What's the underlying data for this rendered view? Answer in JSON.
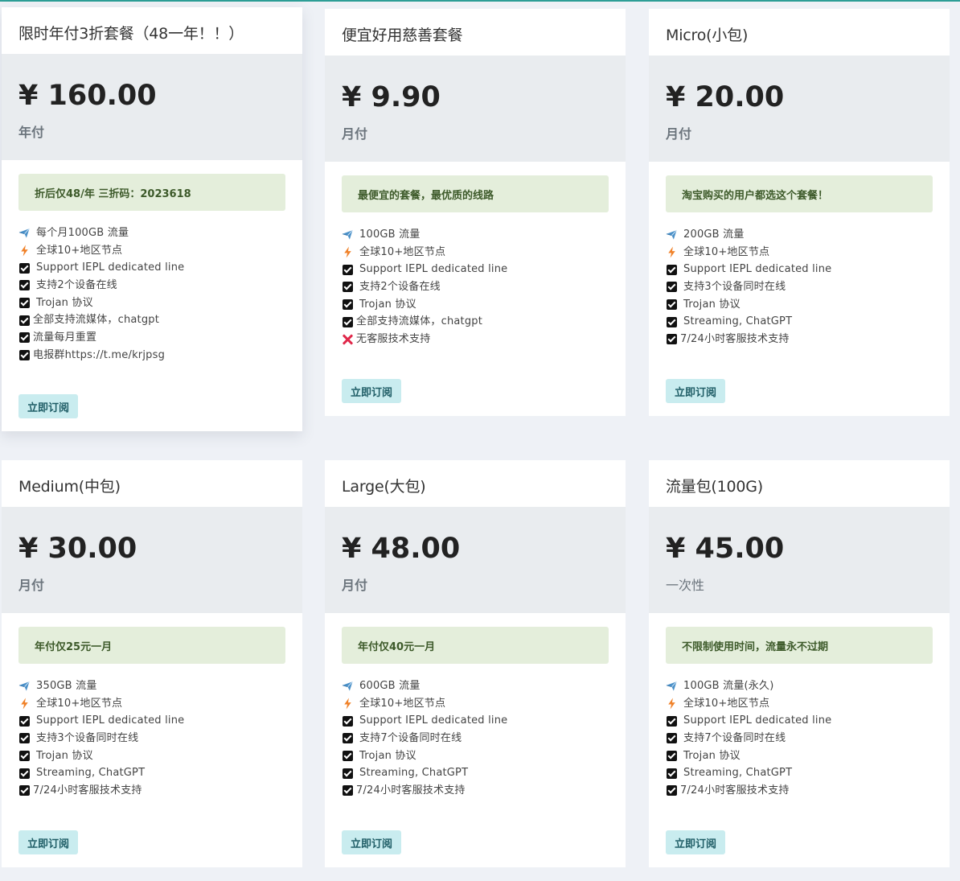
{
  "plans": [
    {
      "title": "限时年付3折套餐（48一年！！）",
      "price": "¥ 160.00",
      "period": "年付",
      "note": "折后仅48/年 三折码：2023618",
      "features": [
        {
          "icon": "plane-icon",
          "text": "每个月100GB 流量"
        },
        {
          "icon": "lightning-icon",
          "text": "全球10+地区节点"
        },
        {
          "icon": "check-icon",
          "text": "Support IEPL dedicated line"
        },
        {
          "icon": "check-icon",
          "text": "支持2个设备在线"
        },
        {
          "icon": "check-icon",
          "text": "Trojan 协议"
        },
        {
          "icon": "check-icon",
          "text": "全部支持流媒体，chatgpt"
        },
        {
          "icon": "check-icon",
          "text": "流量每月重置"
        },
        {
          "icon": "check-icon",
          "text": "电报群https://t.me/krjpsg"
        }
      ],
      "button": "立即订阅"
    },
    {
      "title": "便宜好用慈善套餐",
      "price": "¥ 9.90",
      "period": "月付",
      "note": "最便宜的套餐，最优质的线路",
      "features": [
        {
          "icon": "plane-icon",
          "text": "100GB 流量"
        },
        {
          "icon": "lightning-icon",
          "text": "全球10+地区节点"
        },
        {
          "icon": "check-icon",
          "text": "Support IEPL dedicated line"
        },
        {
          "icon": "check-icon",
          "text": "支持2个设备在线"
        },
        {
          "icon": "check-icon",
          "text": "Trojan 协议"
        },
        {
          "icon": "check-icon",
          "text": "全部支持流媒体，chatgpt"
        },
        {
          "icon": "cross-icon",
          "text": "无客服技术支持"
        }
      ],
      "button": "立即订阅"
    },
    {
      "title": "Micro(小包)",
      "price": "¥ 20.00",
      "period": "月付",
      "note": "淘宝购买的用户都选这个套餐！",
      "features": [
        {
          "icon": "plane-icon",
          "text": "200GB 流量"
        },
        {
          "icon": "lightning-icon",
          "text": "全球10+地区节点"
        },
        {
          "icon": "check-icon",
          "text": "Support IEPL dedicated line"
        },
        {
          "icon": "check-icon",
          "text": "支持3个设备同时在线"
        },
        {
          "icon": "check-icon",
          "text": "Trojan 协议"
        },
        {
          "icon": "check-icon",
          "text": "Streaming, ChatGPT"
        },
        {
          "icon": "check-icon",
          "text": "7/24小时客服技术支持"
        }
      ],
      "button": "立即订阅"
    },
    {
      "title": "Medium(中包)",
      "price": "¥ 30.00",
      "period": "月付",
      "note": "年付仅25元一月",
      "features": [
        {
          "icon": "plane-icon",
          "text": "350GB 流量"
        },
        {
          "icon": "lightning-icon",
          "text": "全球10+地区节点"
        },
        {
          "icon": "check-icon",
          "text": "Support IEPL dedicated line"
        },
        {
          "icon": "check-icon",
          "text": "支持3个设备同时在线"
        },
        {
          "icon": "check-icon",
          "text": "Trojan 协议"
        },
        {
          "icon": "check-icon",
          "text": "Streaming, ChatGPT"
        },
        {
          "icon": "check-icon",
          "text": "7/24小时客服技术支持"
        }
      ],
      "button": "立即订阅"
    },
    {
      "title": "Large(大包)",
      "price": "¥ 48.00",
      "period": "月付",
      "note": "年付仅40元一月",
      "features": [
        {
          "icon": "plane-icon",
          "text": "600GB 流量"
        },
        {
          "icon": "lightning-icon",
          "text": "全球10+地区节点"
        },
        {
          "icon": "check-icon",
          "text": "Support IEPL dedicated line"
        },
        {
          "icon": "check-icon",
          "text": "支持7个设备同时在线"
        },
        {
          "icon": "check-icon",
          "text": "Trojan 协议"
        },
        {
          "icon": "check-icon",
          "text": "Streaming, ChatGPT"
        },
        {
          "icon": "check-icon",
          "text": "7/24小时客服技术支持"
        }
      ],
      "button": "立即订阅"
    },
    {
      "title": "流量包(100G)",
      "price": "¥ 45.00",
      "period": "一次性",
      "note": "不限制使用时间，流量永不过期",
      "features": [
        {
          "icon": "plane-icon",
          "text": "100GB 流量(永久)"
        },
        {
          "icon": "lightning-icon",
          "text": "全球10+地区节点"
        },
        {
          "icon": "check-icon",
          "text": "Support IEPL dedicated line"
        },
        {
          "icon": "check-icon",
          "text": "支持7个设备同时在线"
        },
        {
          "icon": "check-icon",
          "text": "Trojan 协议"
        },
        {
          "icon": "check-icon",
          "text": "Streaming, ChatGPT"
        },
        {
          "icon": "check-icon",
          "text": "7/24小时客服技术支持"
        }
      ],
      "button": "立即订阅"
    }
  ],
  "colors": {
    "page_background": "#eef1f6",
    "price_band": "#e9ecef",
    "note_background": "#e4eedb",
    "button_background": "#c9ecef",
    "accent_topline": "#2d9e96"
  }
}
